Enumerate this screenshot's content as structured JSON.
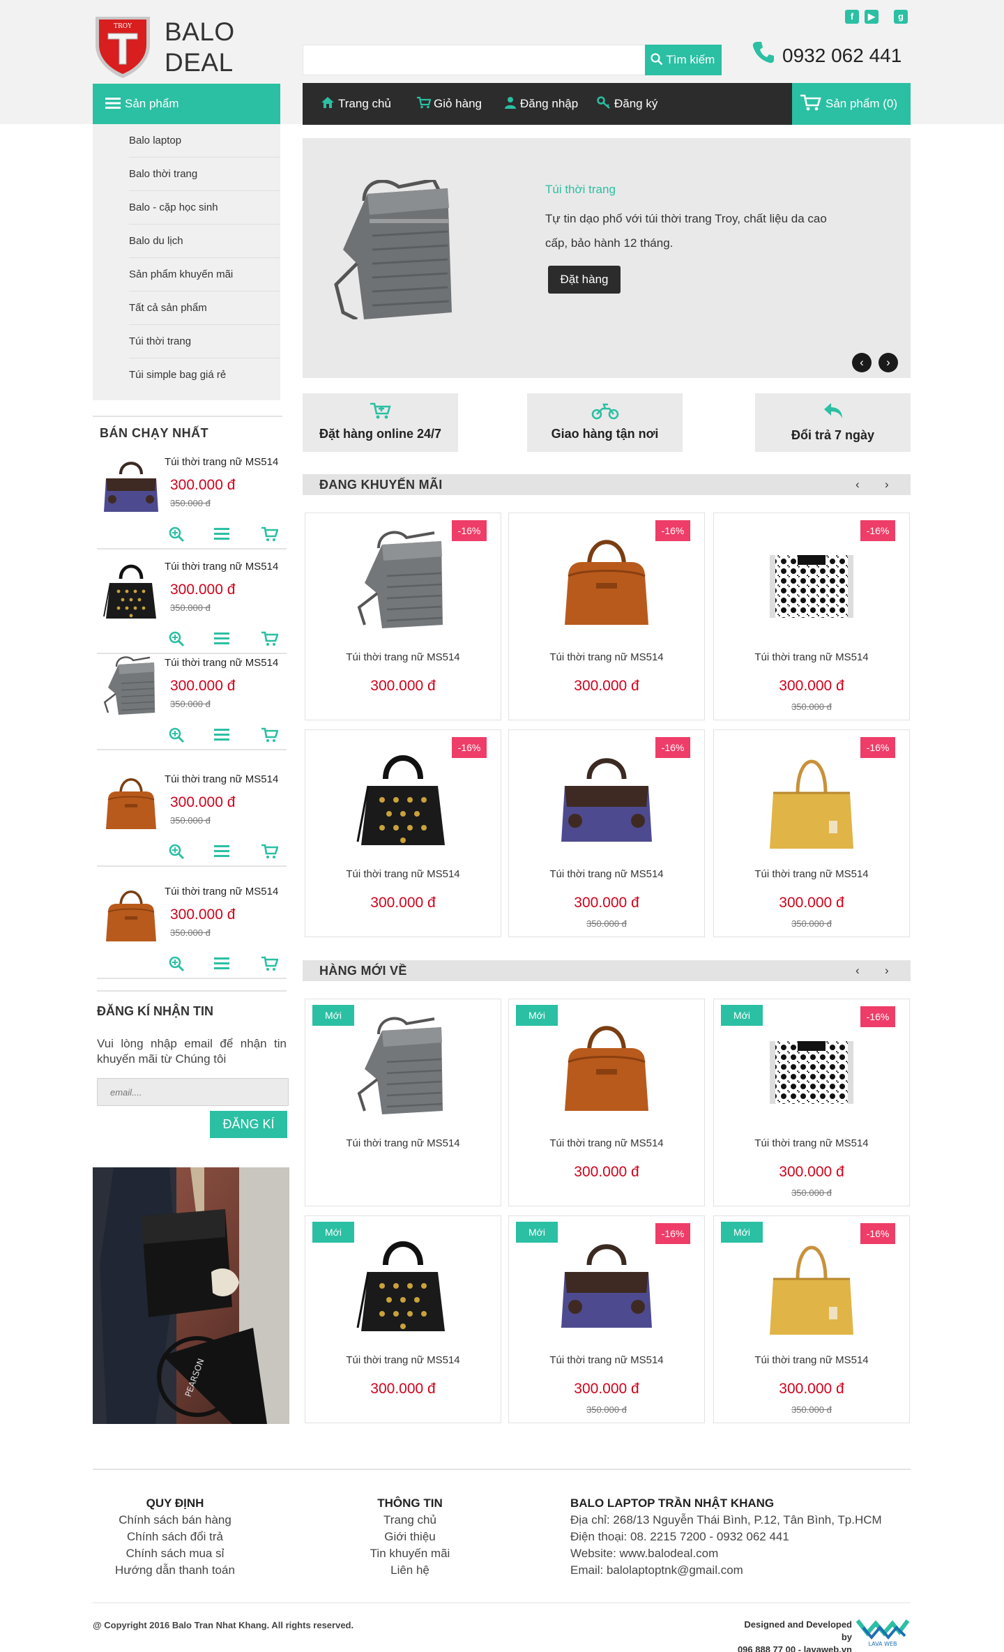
{
  "header": {
    "brand_line1": "BALO",
    "brand_line2": "DEAL",
    "logo_text": "TROY",
    "search_placeholder": "",
    "search_button": "Tìm kiếm",
    "phone": "0932 062 441",
    "social": [
      "facebook-icon",
      "youtube-icon",
      "google-plus-icon"
    ]
  },
  "nav": {
    "category_button": "Sản phẩm",
    "items": [
      "Trang chủ",
      "Giỏ hàng",
      "Đăng nhập",
      "Đăng ký"
    ],
    "cart": "Sản phẩm (0)"
  },
  "categories": [
    "Balo laptop",
    "Balo thời trang",
    "Balo - cặp học sinh",
    "Balo du lịch",
    "Sản phẩm khuyến mãi",
    "Tất cả sản phẩm",
    "Túi thời trang",
    "Túi simple bag giá rẻ"
  ],
  "bestsellers": {
    "title": "BÁN CHẠY NHẤT",
    "items": [
      {
        "name": "Túi thời trang nữ MS514",
        "price": "300.000 đ",
        "old": "350.000 đ"
      },
      {
        "name": "Túi thời trang nữ MS514",
        "price": "300.000 đ",
        "old": "350.000 đ"
      },
      {
        "name": "Túi thời trang nữ MS514",
        "price": "300.000 đ",
        "old": "350.000 đ"
      },
      {
        "name": "Túi thời trang nữ MS514",
        "price": "300.000 đ",
        "old": "350.000 đ"
      },
      {
        "name": "Túi thời trang nữ MS514",
        "price": "300.000 đ",
        "old": "350.000 đ"
      }
    ]
  },
  "newsletter": {
    "title": "ĐĂNG KÍ NHẬN TIN",
    "desc": "Vui lòng nhập email để nhận tin khuyến mãi từ Chúng tôi",
    "placeholder": "email....",
    "button": "ĐĂNG KÍ"
  },
  "slider": {
    "title": "Túi thời trang",
    "desc": "Tự tin dạo phố với túi thời trang Troy, chất liệu da cao cấp, bảo hành 12 tháng.",
    "button": "Đặt hàng"
  },
  "features": [
    "Đặt hàng online 24/7",
    "Giao hàng tận nơi",
    "Đổi trả 7 ngày"
  ],
  "promo": {
    "title": "ĐANG KHUYẾN MÃI",
    "products": [
      {
        "name": "Túi thời trang nữ MS514",
        "price": "300.000 đ",
        "old": "",
        "badge": "-16%"
      },
      {
        "name": "Túi thời trang nữ MS514",
        "price": "300.000 đ",
        "old": "",
        "badge": "-16%"
      },
      {
        "name": "Túi thời trang nữ MS514",
        "price": "300.000 đ",
        "old": "350.000 đ",
        "badge": "-16%"
      },
      {
        "name": "Túi thời trang nữ MS514",
        "price": "300.000 đ",
        "old": "",
        "badge": "-16%"
      },
      {
        "name": "Túi thời trang nữ MS514",
        "price": "300.000 đ",
        "old": "350.000 đ",
        "badge": "-16%"
      },
      {
        "name": "Túi thời trang nữ MS514",
        "price": "300.000 đ",
        "old": "350.000 đ",
        "badge": "-16%"
      }
    ]
  },
  "newarrivals": {
    "title": "HÀNG MỚI VỀ",
    "new_label": "Mới",
    "products": [
      {
        "name": "Túi thời trang nữ MS514",
        "price": "",
        "old": "",
        "badge": ""
      },
      {
        "name": "Túi thời trang nữ MS514",
        "price": "300.000 đ",
        "old": "",
        "badge": ""
      },
      {
        "name": "Túi thời trang nữ MS514",
        "price": "300.000 đ",
        "old": "350.000 đ",
        "badge": "-16%"
      },
      {
        "name": "Túi thời trang nữ MS514",
        "price": "300.000 đ",
        "old": "",
        "badge": ""
      },
      {
        "name": "Túi thời trang nữ MS514",
        "price": "300.000 đ",
        "old": "350.000 đ",
        "badge": "-16%"
      },
      {
        "name": "Túi thời trang nữ MS514",
        "price": "300.000 đ",
        "old": "350.000 đ",
        "badge": "-16%"
      }
    ]
  },
  "footer": {
    "col1": {
      "title": "QUY ĐỊNH",
      "links": [
        "Chính sách bán hàng",
        "Chính sách đổi trả",
        "Chính sách mua sỉ",
        "Hướng dẫn thanh toán"
      ]
    },
    "col2": {
      "title": "THÔNG TIN",
      "links": [
        "Trang chủ",
        "Giới thiệu",
        "Tin khuyến mãi",
        "Liên hệ"
      ]
    },
    "col3": {
      "title": "BALO LAPTOP TRẦN NHẬT KHANG",
      "lines": [
        "Địa chỉ: 268/13 Nguyễn Thái Bình, P.12, Tân Bình, Tp.HCM",
        "Điện thoại: 08. 2215 7200 - 0932 062 441",
        "Website: www.balodeal.com",
        "Email: balolaptoptnk@gmail.com"
      ]
    },
    "copyright": "@ Copyright 2016 Balo Tran Nhat Khang. All rights reserved.",
    "credit1": "Designed and Developed by",
    "credit2": "096 888 77 00 - lavaweb.vn",
    "lava_label": "LAVA WEB"
  },
  "colors": {
    "accent": "#2bbfa3",
    "price": "#d0021b",
    "sale_badge": "#ee3d68",
    "nav_bg": "#2c2c2c"
  }
}
